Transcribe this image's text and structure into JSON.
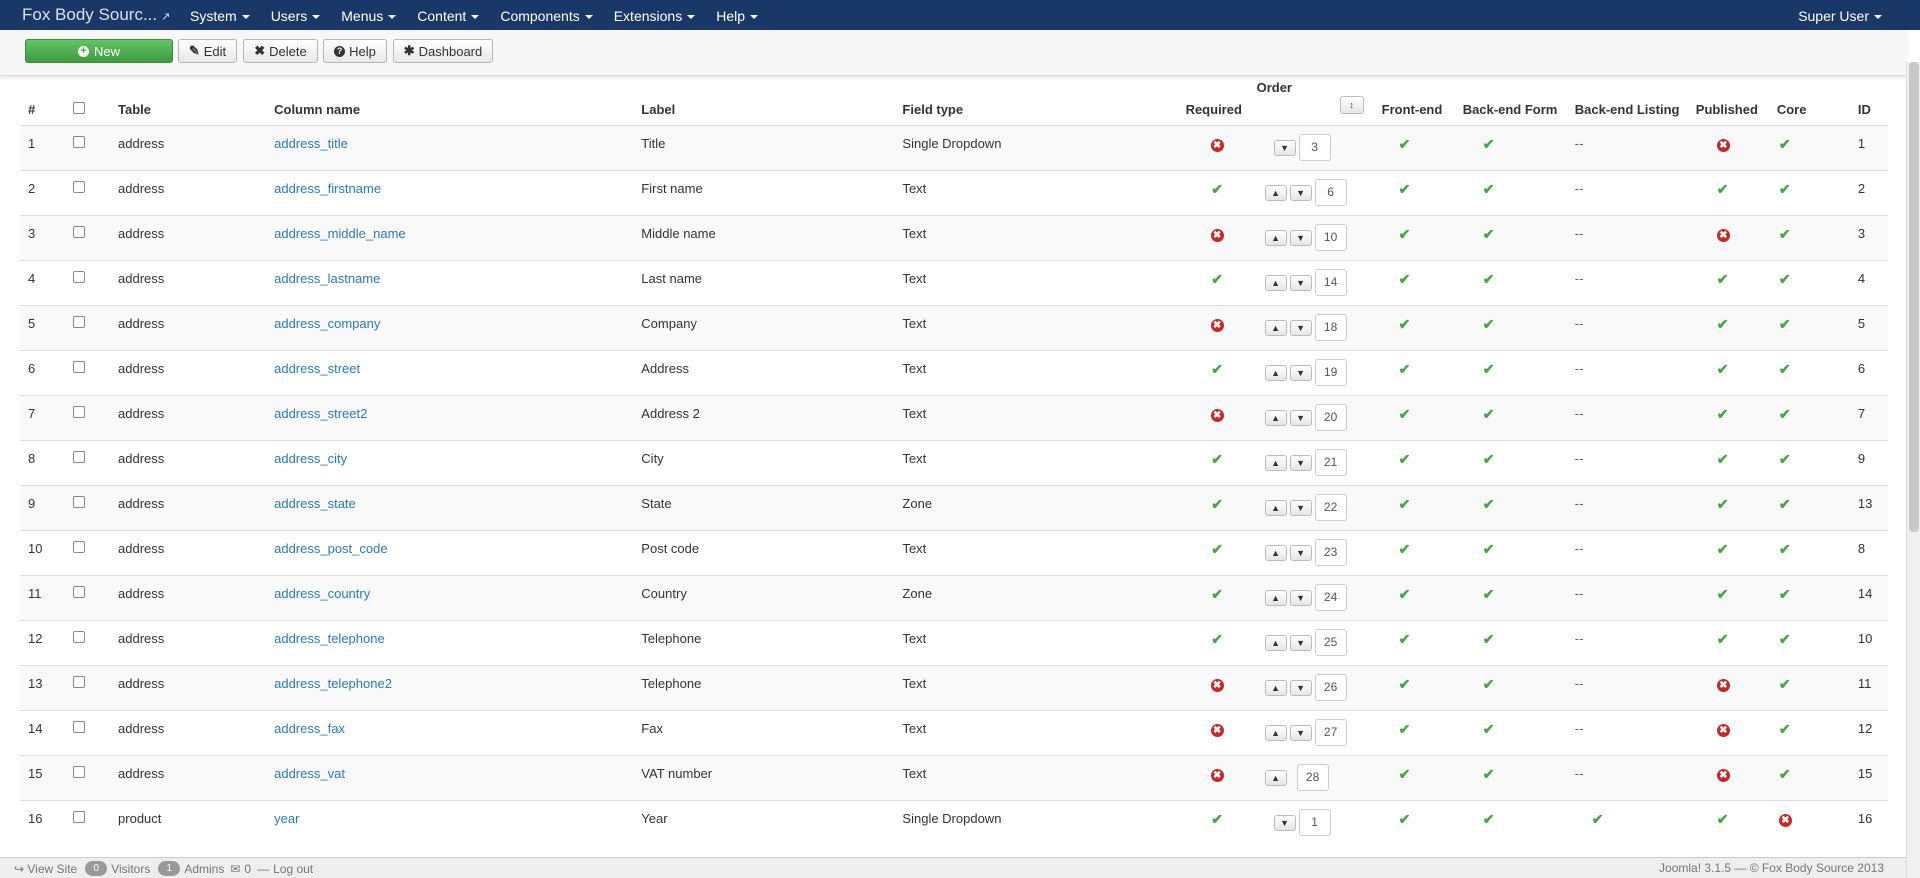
{
  "navbar": {
    "brand": "Fox Body Sourc...",
    "menus": [
      "System",
      "Users",
      "Menus",
      "Content",
      "Components",
      "Extensions",
      "Help"
    ],
    "user": "Super User"
  },
  "toolbar": {
    "new": "New",
    "edit": "Edit",
    "delete": "Delete",
    "help": "Help",
    "dashboard": "Dashboard"
  },
  "table": {
    "headers": {
      "num": "#",
      "table": "Table",
      "column": "Column name",
      "label": "Label",
      "field_type": "Field type",
      "required": "Required",
      "order": "Order",
      "frontend": "Front-end",
      "backend_form": "Back-end Form",
      "backend_listing": "Back-end Listing",
      "published": "Published",
      "core": "Core",
      "id": "ID"
    },
    "rows": [
      {
        "num": "1",
        "table": "address",
        "column": "address_title",
        "label": "Title",
        "type": "Single Dropdown",
        "required": false,
        "up": false,
        "down": true,
        "order": "3",
        "frontend": true,
        "backend_form": true,
        "listing": "--",
        "published": false,
        "core": true,
        "id": "1"
      },
      {
        "num": "2",
        "table": "address",
        "column": "address_firstname",
        "label": "First name",
        "type": "Text",
        "required": true,
        "up": true,
        "down": true,
        "order": "6",
        "frontend": true,
        "backend_form": true,
        "listing": "--",
        "published": true,
        "core": true,
        "id": "2"
      },
      {
        "num": "3",
        "table": "address",
        "column": "address_middle_name",
        "label": "Middle name",
        "type": "Text",
        "required": false,
        "up": true,
        "down": true,
        "order": "10",
        "frontend": true,
        "backend_form": true,
        "listing": "--",
        "published": false,
        "core": true,
        "id": "3"
      },
      {
        "num": "4",
        "table": "address",
        "column": "address_lastname",
        "label": "Last name",
        "type": "Text",
        "required": true,
        "up": true,
        "down": true,
        "order": "14",
        "frontend": true,
        "backend_form": true,
        "listing": "--",
        "published": true,
        "core": true,
        "id": "4"
      },
      {
        "num": "5",
        "table": "address",
        "column": "address_company",
        "label": "Company",
        "type": "Text",
        "required": false,
        "up": true,
        "down": true,
        "order": "18",
        "frontend": true,
        "backend_form": true,
        "listing": "--",
        "published": true,
        "core": true,
        "id": "5"
      },
      {
        "num": "6",
        "table": "address",
        "column": "address_street",
        "label": "Address",
        "type": "Text",
        "required": true,
        "up": true,
        "down": true,
        "order": "19",
        "frontend": true,
        "backend_form": true,
        "listing": "--",
        "published": true,
        "core": true,
        "id": "6"
      },
      {
        "num": "7",
        "table": "address",
        "column": "address_street2",
        "label": "Address 2",
        "type": "Text",
        "required": false,
        "up": true,
        "down": true,
        "order": "20",
        "frontend": true,
        "backend_form": true,
        "listing": "--",
        "published": true,
        "core": true,
        "id": "7"
      },
      {
        "num": "8",
        "table": "address",
        "column": "address_city",
        "label": "City",
        "type": "Text",
        "required": true,
        "up": true,
        "down": true,
        "order": "21",
        "frontend": true,
        "backend_form": true,
        "listing": "--",
        "published": true,
        "core": true,
        "id": "9"
      },
      {
        "num": "9",
        "table": "address",
        "column": "address_state",
        "label": "State",
        "type": "Zone",
        "required": true,
        "up": true,
        "down": true,
        "order": "22",
        "frontend": true,
        "backend_form": true,
        "listing": "--",
        "published": true,
        "core": true,
        "id": "13"
      },
      {
        "num": "10",
        "table": "address",
        "column": "address_post_code",
        "label": "Post code",
        "type": "Text",
        "required": true,
        "up": true,
        "down": true,
        "order": "23",
        "frontend": true,
        "backend_form": true,
        "listing": "--",
        "published": true,
        "core": true,
        "id": "8"
      },
      {
        "num": "11",
        "table": "address",
        "column": "address_country",
        "label": "Country",
        "type": "Zone",
        "required": true,
        "up": true,
        "down": true,
        "order": "24",
        "frontend": true,
        "backend_form": true,
        "listing": "--",
        "published": true,
        "core": true,
        "id": "14"
      },
      {
        "num": "12",
        "table": "address",
        "column": "address_telephone",
        "label": "Telephone",
        "type": "Text",
        "required": true,
        "up": true,
        "down": true,
        "order": "25",
        "frontend": true,
        "backend_form": true,
        "listing": "--",
        "published": true,
        "core": true,
        "id": "10"
      },
      {
        "num": "13",
        "table": "address",
        "column": "address_telephone2",
        "label": "Telephone",
        "type": "Text",
        "required": false,
        "up": true,
        "down": true,
        "order": "26",
        "frontend": true,
        "backend_form": true,
        "listing": "--",
        "published": false,
        "core": true,
        "id": "11"
      },
      {
        "num": "14",
        "table": "address",
        "column": "address_fax",
        "label": "Fax",
        "type": "Text",
        "required": false,
        "up": true,
        "down": true,
        "order": "27",
        "frontend": true,
        "backend_form": true,
        "listing": "--",
        "published": false,
        "core": true,
        "id": "12"
      },
      {
        "num": "15",
        "table": "address",
        "column": "address_vat",
        "label": "VAT number",
        "type": "Text",
        "required": false,
        "up": true,
        "down": false,
        "order": "28",
        "frontend": true,
        "backend_form": true,
        "listing": "--",
        "published": false,
        "core": true,
        "id": "15"
      },
      {
        "num": "16",
        "table": "product",
        "column": "year",
        "label": "Year",
        "type": "Single Dropdown",
        "required": true,
        "up": false,
        "down": true,
        "order": "1",
        "frontend": true,
        "backend_form": true,
        "listing": "check",
        "published": true,
        "core": false,
        "id": "16"
      }
    ]
  },
  "footer": {
    "view_site": "View Site",
    "visitors_count": "0",
    "visitors": "Visitors",
    "admins_count": "1",
    "admins": "Admins",
    "messages_count": "0",
    "logout": "Log out",
    "copyright": "Joomla! 3.1.5 — © Fox Body Source 2013"
  },
  "colors": {
    "navbar": "#1a3867",
    "success": "#46a546",
    "danger": "#c52827",
    "link": "#2b7ab8"
  }
}
